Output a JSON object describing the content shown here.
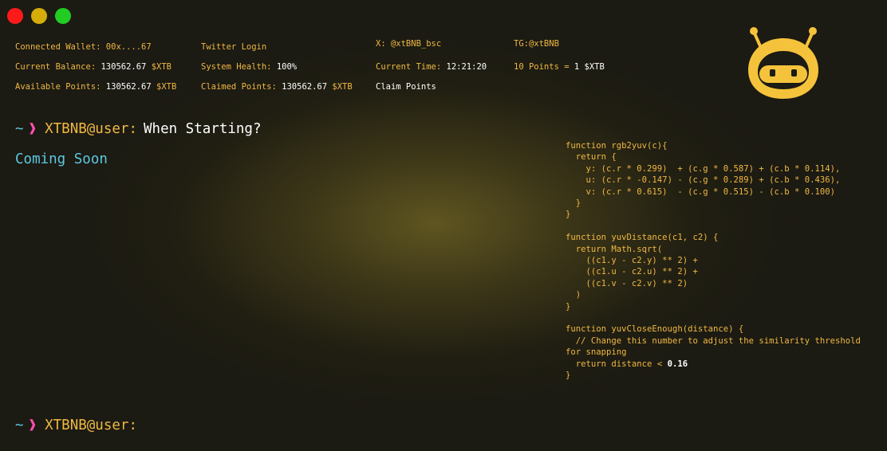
{
  "window": {
    "controls": [
      "close",
      "minimize",
      "maximize"
    ]
  },
  "header": {
    "wallet_label": "Connected Wallet:",
    "wallet_value": "00x....67",
    "twitter_login": "Twitter Login",
    "x_handle": "X: @xtBNB_bsc",
    "tg_handle": "TG:@xtBNB",
    "balance_label": "Current Balance:",
    "balance_value": "130562.67",
    "balance_token": "$XTB",
    "health_label": "System Health:",
    "health_value": "100%",
    "time_label": "Current Time:",
    "time_value": "12:21:20",
    "rate_text": "10 Points =",
    "rate_value": "1 $XTB",
    "available_label": "Available Points:",
    "available_value": "130562.67",
    "available_token": "$XTB",
    "claimed_label": "Claimed Points:",
    "claimed_value": "130562.67",
    "claimed_token": "$XTB",
    "claim_button": "Claim Points"
  },
  "terminal": {
    "tilde": "~",
    "arrow": "❱",
    "host": "XTBNB@user:",
    "command": "When Starting?",
    "output": "Coming Soon"
  },
  "code_lines": [
    "function rgb2yuv(c){",
    "  return {",
    "    y: (c.r * 0.299)  + (c.g * 0.587) + (c.b * 0.114),",
    "    u: (c.r * -0.147) - (c.g * 0.289) + (c.b * 0.436),",
    "    v: (c.r * 0.615)  - (c.g * 0.515) - (c.b * 0.100)",
    "  }",
    "}",
    "",
    "function yuvDistance(c1, c2) {",
    "  return Math.sqrt(",
    "    ((c1.y - c2.y) ** 2) +",
    "    ((c1.u - c2.u) ** 2) +",
    "    ((c1.v - c2.v) ** 2)",
    "  )",
    "}",
    "",
    "function yuvCloseEnough(distance) {",
    "  // Change this number to adjust the similarity threshold for snapping",
    "  return distance < ",
    "}"
  ],
  "code_threshold": "0.16",
  "colors": {
    "accent": "#f0b842",
    "cyan": "#5ec8e0",
    "pink": "#ff4fae",
    "mascot": "#f5c33b"
  },
  "icons": {
    "mascot": "robot-mascot-icon"
  }
}
